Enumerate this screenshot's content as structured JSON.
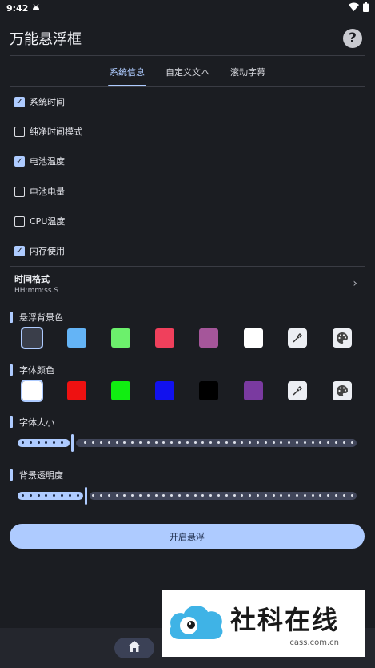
{
  "status_bar": {
    "time": "9:42",
    "notification_icon": "android-icon",
    "wifi_icon": "wifi-icon",
    "battery_icon": "battery-icon"
  },
  "app": {
    "title": "万能悬浮框",
    "help_label": "?"
  },
  "tabs": [
    {
      "label": "系统信息",
      "active": true
    },
    {
      "label": "自定义文本",
      "active": false
    },
    {
      "label": "滚动字幕",
      "active": false
    }
  ],
  "checkboxes": [
    {
      "label": "系统时间",
      "checked": true
    },
    {
      "label": "纯净时间模式",
      "checked": false
    },
    {
      "label": "电池温度",
      "checked": true
    },
    {
      "label": "电池电量",
      "checked": false
    },
    {
      "label": "CPU温度",
      "checked": false
    },
    {
      "label": "内存使用",
      "checked": true
    }
  ],
  "time_format": {
    "title": "时间格式",
    "value": "HH:mm:ss.S"
  },
  "bg_color": {
    "title": "悬浮背景色",
    "swatches": [
      "#3a3e4a",
      "#64b4f6",
      "#6cf06c",
      "#f0405c",
      "#a5569a",
      "#ffffff"
    ],
    "selected_index": 0
  },
  "font_color": {
    "title": "字体颜色",
    "swatches": [
      "#ffffff",
      "#ee1111",
      "#11ee11",
      "#1111ee",
      "#000000",
      "#7a3aa0"
    ],
    "selected_index": 0
  },
  "font_size": {
    "title": "字体大小",
    "value_fraction": 0.16
  },
  "bg_opacity": {
    "title": "背景透明度",
    "value_fraction": 0.2
  },
  "start_button": {
    "label": "开启悬浮"
  },
  "watermark": {
    "title": "社科在线",
    "url": "cass.com.cn"
  },
  "colors": {
    "accent": "#aecbff",
    "background": "#1b1d22",
    "track": "#41465a"
  }
}
